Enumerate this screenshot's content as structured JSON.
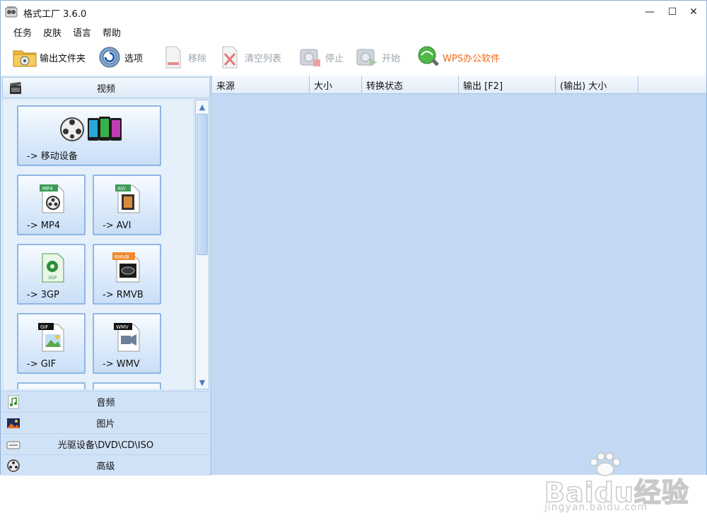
{
  "window": {
    "title": "格式工厂 3.6.0",
    "icon": "format-factory-icon",
    "controls": {
      "minimize": "—",
      "maximize": "☐",
      "close": "✕"
    }
  },
  "menu": [
    "任务",
    "皮肤",
    "语言",
    "帮助"
  ],
  "toolbar": {
    "output_folder": "输出文件夹",
    "options": "选项",
    "remove": "移除",
    "clear_list": "清空列表",
    "stop": "停止",
    "start": "开始",
    "wps": "WPS办公软件"
  },
  "sidebar": {
    "video": {
      "label": "视频",
      "tiles": [
        {
          "label": "-> 移动设备",
          "badge": ""
        },
        {
          "label": "-> MP4",
          "badge": "MP4"
        },
        {
          "label": "-> AVI",
          "badge": "AVI"
        },
        {
          "label": "-> 3GP",
          "badge": "3GP"
        },
        {
          "label": "-> RMVB",
          "badge": "RMVB"
        },
        {
          "label": "-> GIF",
          "badge": "GIF"
        },
        {
          "label": "-> WMV",
          "badge": "WMV"
        }
      ]
    },
    "audio": {
      "label": "音频"
    },
    "picture": {
      "label": "图片"
    },
    "rom": {
      "label": "光驱设备\\DVD\\CD\\ISO"
    },
    "advanced": {
      "label": "高级"
    }
  },
  "table": {
    "columns": [
      "来源",
      "大小",
      "转换状态",
      "输出 [F2]",
      "(输出) 大小"
    ]
  },
  "watermark": {
    "logo": "Baidu经验",
    "url": "jingyan.baidu.com"
  },
  "colors": {
    "window_bg": "#c8dcf3",
    "tile_border": "#8fb6e6",
    "wps_accent": "#ef6a1a",
    "disabled_text": "#9aa3ad"
  }
}
